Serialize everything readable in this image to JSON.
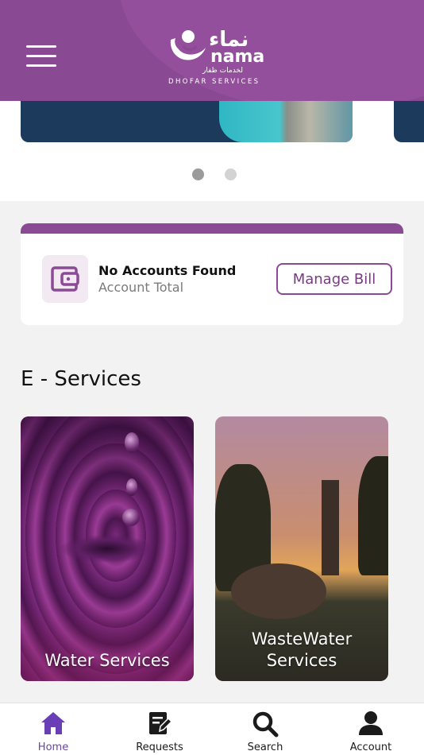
{
  "header": {
    "logo_arabic": "نماء",
    "logo_latin": "nama",
    "logo_arabic_sub": "لخدمات ظفار",
    "logo_sub": "DHOFAR SERVICES",
    "brand_color": "#8a4a93"
  },
  "banner": {
    "slide_count": 2,
    "active_slide": 1
  },
  "account": {
    "title": "No Accounts Found",
    "subtitle": "Account Total",
    "manage_label": "Manage Bill"
  },
  "eservices": {
    "title": "E - Services",
    "items": [
      {
        "label": "Water Services"
      },
      {
        "label_line1": "WasteWater",
        "label_line2": "Services"
      }
    ]
  },
  "tabs": [
    {
      "label": "Home",
      "icon": "home-icon",
      "active": true
    },
    {
      "label": "Requests",
      "icon": "edit-note-icon",
      "active": false
    },
    {
      "label": "Search",
      "icon": "search-icon",
      "active": false
    },
    {
      "label": "Account",
      "icon": "user-icon",
      "active": false
    }
  ],
  "colors": {
    "accent": "#8b4a94",
    "tab_active": "#6a3fb5"
  }
}
